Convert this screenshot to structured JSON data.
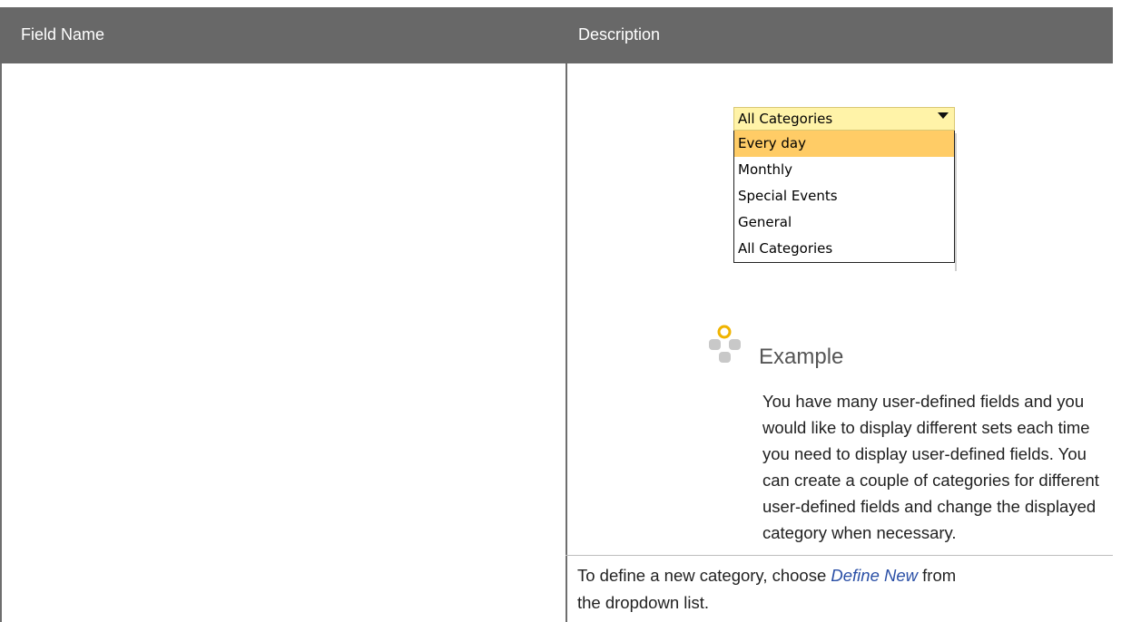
{
  "table": {
    "header": {
      "col1": "Field Name",
      "col2": "Description"
    }
  },
  "dropdown": {
    "selected_value": "All Categories",
    "options": [
      "Every day",
      "Monthly",
      "Special Events",
      "General",
      "All Categories"
    ],
    "highlighted_option": "Every day"
  },
  "example": {
    "title": "Example",
    "text": "You have many user-defined fields and you would like to display different sets each time you need to display user-defined fields. You can create a couple of categories for different user-defined fields and change the displayed category when necessary."
  },
  "instruction": {
    "before": "To define a new category, choose ",
    "link": "Define New",
    "after": " from the dropdown list."
  },
  "colors": {
    "header_bg": "#686868",
    "dropdown_bg": "#fff3a8",
    "highlight_bg": "#ffcc66",
    "link": "#2a4fa6"
  }
}
